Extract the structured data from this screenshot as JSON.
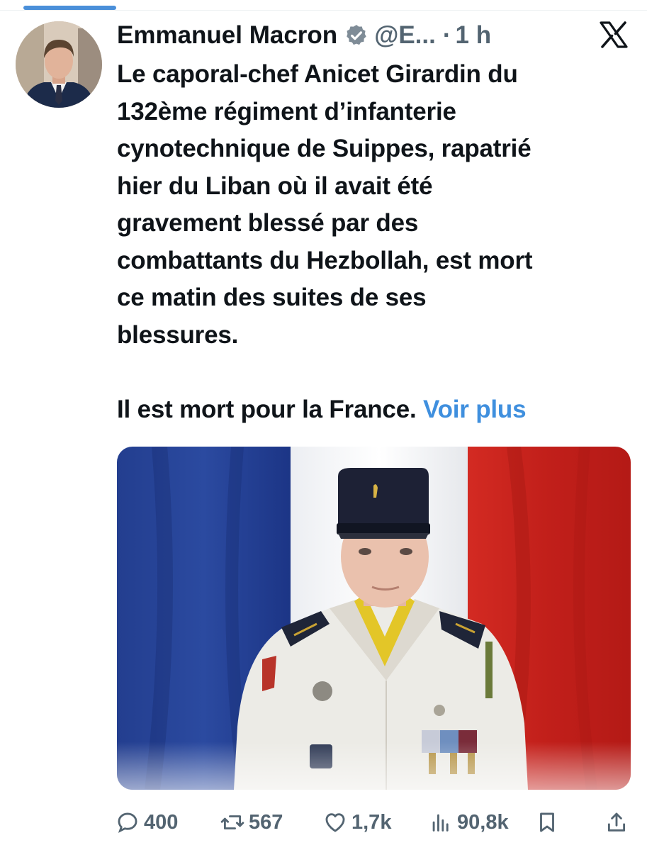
{
  "tweet": {
    "author_name": "Emmanuel Macron",
    "handle": "@E...",
    "separator": "·",
    "time": "1 h",
    "text_lines": [
      "Le caporal-chef Anicet Girardin du",
      "132ème régiment d’infanterie",
      "cynotechnique de Suippes, rapatrié",
      "hier du Liban où il avait été",
      "gravement blessé par des",
      "combattants du Hezbollah, est mort",
      "ce matin des suites de ses",
      "blessures."
    ],
    "last_line": "Il est mort pour la France.",
    "voir_plus": "Voir plus"
  },
  "actions": {
    "replies": "400",
    "reposts": "567",
    "likes": "1,7k",
    "views": "90,8k"
  },
  "icons": {
    "verified": "verified-badge-icon",
    "platform": "x-logo-icon",
    "reply": "reply-icon",
    "repost": "repost-icon",
    "like": "heart-icon",
    "views": "views-chart-icon",
    "bookmark": "bookmark-icon",
    "share": "share-icon"
  },
  "colors": {
    "link": "#3f8fde",
    "secondary": "#536471",
    "flag_blue": "#1f3a8c",
    "flag_red": "#c8231e"
  }
}
